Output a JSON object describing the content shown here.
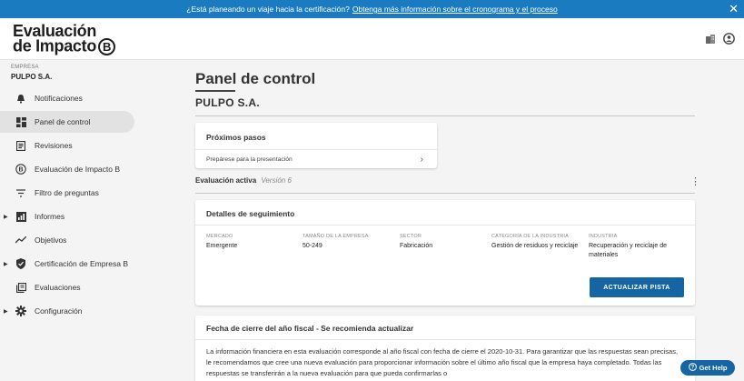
{
  "banner": {
    "text": "¿Está planeando un viaje hacia la certificación?",
    "link": "Obtenga más información sobre el cronograma y el proceso",
    "close_icon": "close-icon"
  },
  "header": {
    "logo_line1": "Evaluación",
    "logo_line2": "de Impacto",
    "logo_mark": "B",
    "icons": [
      "building-icon",
      "user-circle-icon"
    ]
  },
  "sidebar": {
    "company_label": "EMPRESA",
    "company_name": "PULPO S.A.",
    "items": [
      {
        "label": "Notificaciones",
        "icon": "bell-icon",
        "expandable": false
      },
      {
        "label": "Panel de control",
        "icon": "dashboard-icon",
        "expandable": false,
        "active": true
      },
      {
        "label": "Revisiones",
        "icon": "review-icon",
        "expandable": false
      },
      {
        "label": "Evaluación de Impacto B",
        "icon": "b-circle-icon",
        "expandable": false
      },
      {
        "label": "Filtro de preguntas",
        "icon": "filter-icon",
        "expandable": false
      },
      {
        "label": "Informes",
        "icon": "report-icon",
        "expandable": true
      },
      {
        "label": "Objetivos",
        "icon": "trend-icon",
        "expandable": false
      },
      {
        "label": "Certificación de Empresa B",
        "icon": "shield-icon",
        "expandable": true
      },
      {
        "label": "Evaluaciones",
        "icon": "copy-icon",
        "expandable": false
      },
      {
        "label": "Configuración",
        "icon": "gear-icon",
        "expandable": true
      }
    ],
    "caret": "▶"
  },
  "main": {
    "page_title": "Panel de control",
    "company_title": "PULPO S.A.",
    "next_steps": {
      "title": "Próximos pasos",
      "item": "Prepárese para la presentación",
      "chevron": "›"
    },
    "active_eval": {
      "label": "Evaluación activa",
      "version": "Versión 6",
      "menu": "⋮"
    },
    "tracking": {
      "title": "Detalles de seguimiento",
      "fields": [
        {
          "label": "MERCADO",
          "value": "Emergente"
        },
        {
          "label": "TAMAÑO DE LA EMPRESA",
          "value": "50-249"
        },
        {
          "label": "SECTOR",
          "value": "Fabricación"
        },
        {
          "label": "CATEGORÍA DE LA INDUSTRIA",
          "value": "Gestión de residuos y reciclaje"
        },
        {
          "label": "INDUSTRIA",
          "value": "Recuperación y reciclaje de materiales"
        }
      ],
      "button": "ACTUALIZAR PISTA"
    },
    "fiscal": {
      "title": "Fecha de cierre del año fiscal - Se recomienda actualizar",
      "body": "La información financiera en esta evaluación corresponde al año fiscal con fecha de cierre el 2020-10-31. Para garantizar que las respuestas sean precisas, le recomendamos que cree una nueva evaluación para proporcionar información sobre el último año fiscal que la empresa haya completado. Todas las respuestas se transferirán a la nueva evaluación para que pueda confirmarlas o"
    }
  },
  "help": {
    "label": "Get Help",
    "icon": "help-circle-icon"
  },
  "colors": {
    "brand_blue": "#1b7bc1",
    "button_blue": "#1565a5"
  }
}
